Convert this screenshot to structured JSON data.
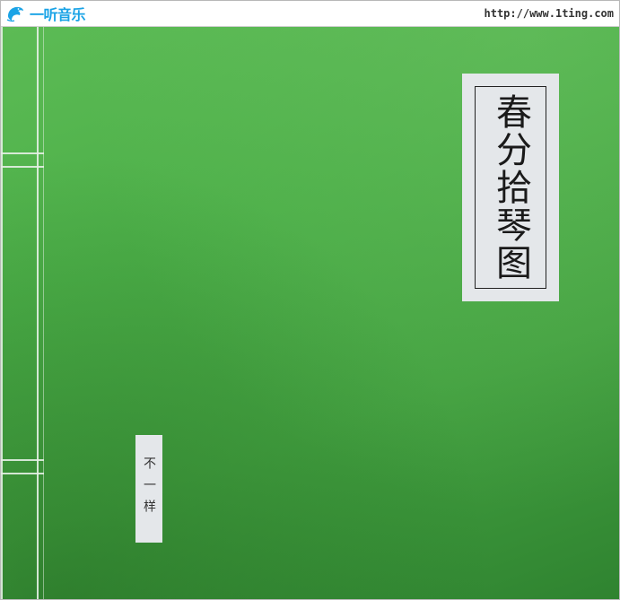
{
  "header": {
    "logo_text": "一听音乐",
    "logo_icon": "dolphin-icon",
    "site_url": "http://www.1ting.com"
  },
  "cover": {
    "title": "春分拾琴图",
    "artist": "不一样",
    "background_color": "#4caf48",
    "label_color": "#e4e7ea",
    "logo_color": "#1aa3e6"
  }
}
